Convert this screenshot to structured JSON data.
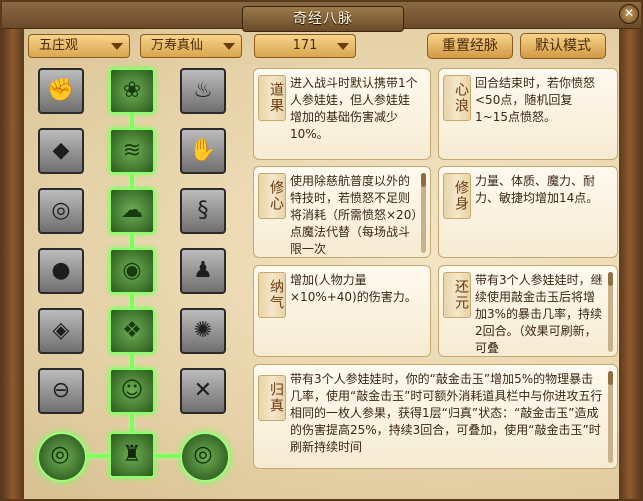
{
  "window": {
    "title": "奇经八脉"
  },
  "toolbar": {
    "dropdown_sect": "五庄观",
    "dropdown_school": "万寿真仙",
    "dropdown_level": "171",
    "reset_label": "重置经脉",
    "default_label": "默认模式"
  },
  "cards": [
    {
      "tag": "道果",
      "text": "进入战斗时默认携带1个人参娃娃，但人参娃娃增加的基础伤害减少10%。"
    },
    {
      "tag": "心浪",
      "text": "回合结束时，若你愤怒<50点，随机回复1~15点愤怒。"
    },
    {
      "tag": "修心",
      "text": "使用除慈航普度以外的特技时，若愤怒不足则将消耗（所需愤怒×20）点魔法代替（每场战斗限一次"
    },
    {
      "tag": "修身",
      "text": "力量、体质、魔力、耐力、敏捷均增加14点。"
    },
    {
      "tag": "纳气",
      "text": "增加(人物力量×10%+40)的伤害力。"
    },
    {
      "tag": "还元",
      "text": "带有3个人参娃娃时，继续使用敲金击玉后将增加3%的暴击几率，持续2回合。（效果可刷新，可叠"
    },
    {
      "tag": "归真",
      "text": "带有3个人参娃娃时，你的“敲金击玉”增加5%的物理暴击几率，使用“敲金击玉”时可额外消耗道具栏中与你进攻五行相同的一枚人参果，获得1层“归真”状态：“敲金击玉”造成的伤害提高25%，持续3回合，可叠加，使用“敲金击玉”时刷新持续时间"
    }
  ],
  "colors": {
    "active_glow": "#7dff5b",
    "accent_gold": "#d9a64e",
    "text_brown": "#3a2614"
  },
  "icons": [
    "fist-icon",
    "lotus-icon",
    "cauldron-icon",
    "rock-icon",
    "wave-icon",
    "palm-icon",
    "eye-icon",
    "cloud-swirl-icon",
    "serpent-icon",
    "boulders-icon",
    "orb-icon",
    "figure-icon",
    "stones-icon",
    "crystal-icon",
    "swirl-icon",
    "circle-bar-icon",
    "face-icon",
    "cross-icon",
    "round-left-icon",
    "totem-icon",
    "round-right-icon"
  ]
}
